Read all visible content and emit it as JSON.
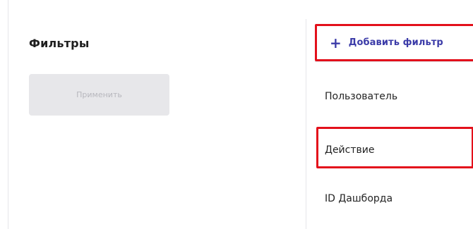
{
  "filters": {
    "title": "Фильтры",
    "apply_label": "Применить"
  },
  "dropdown": {
    "add_label": "Добавить фильтр",
    "items": [
      {
        "label": "Пользователь"
      },
      {
        "label": "Действие"
      },
      {
        "label": "ID Дашборда"
      }
    ]
  },
  "colors": {
    "accent": "#3b3ba8",
    "highlight": "#e3101b",
    "button_bg": "#e7e7ea",
    "button_text": "#b7b7bd"
  },
  "icons": {
    "add": "plus-icon"
  }
}
